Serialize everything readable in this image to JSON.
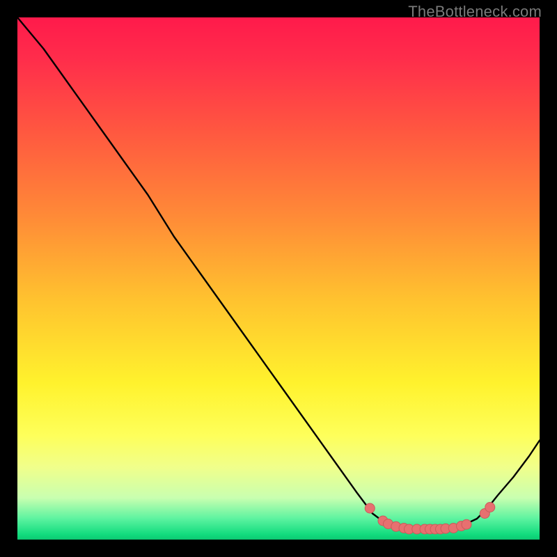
{
  "attribution": "TheBottleneck.com",
  "colors": {
    "curve_stroke": "#000000",
    "marker_fill": "#e77070",
    "marker_stroke": "#ca5a5a"
  },
  "chart_data": {
    "type": "line",
    "title": "",
    "xlabel": "",
    "ylabel": "",
    "xlim": [
      0,
      100
    ],
    "ylim": [
      0,
      100
    ],
    "grid": false,
    "legend": false,
    "curve_xy": [
      [
        0,
        100
      ],
      [
        5,
        94
      ],
      [
        10,
        87
      ],
      [
        15,
        80
      ],
      [
        20,
        73
      ],
      [
        25,
        66
      ],
      [
        30,
        58
      ],
      [
        35,
        51
      ],
      [
        40,
        44
      ],
      [
        45,
        37
      ],
      [
        50,
        30
      ],
      [
        55,
        23
      ],
      [
        60,
        16
      ],
      [
        65,
        9
      ],
      [
        68,
        5
      ],
      [
        70,
        3.5
      ],
      [
        72,
        2.5
      ],
      [
        75,
        2
      ],
      [
        78,
        2
      ],
      [
        80,
        2
      ],
      [
        83,
        2.2
      ],
      [
        85,
        2.6
      ],
      [
        88,
        4
      ],
      [
        90,
        6
      ],
      [
        92,
        8.5
      ],
      [
        95,
        12
      ],
      [
        98,
        16
      ],
      [
        100,
        19
      ]
    ],
    "markers_xy": [
      [
        67.5,
        6.0
      ],
      [
        70.0,
        3.6
      ],
      [
        71.0,
        3.0
      ],
      [
        72.5,
        2.5
      ],
      [
        74.0,
        2.2
      ],
      [
        75.0,
        2.0
      ],
      [
        76.5,
        2.0
      ],
      [
        78.0,
        2.0
      ],
      [
        79.0,
        2.0
      ],
      [
        80.0,
        2.0
      ],
      [
        81.0,
        2.0
      ],
      [
        82.0,
        2.1
      ],
      [
        83.5,
        2.2
      ],
      [
        85.0,
        2.6
      ],
      [
        86.0,
        2.9
      ],
      [
        89.5,
        5.0
      ],
      [
        90.5,
        6.2
      ]
    ]
  }
}
